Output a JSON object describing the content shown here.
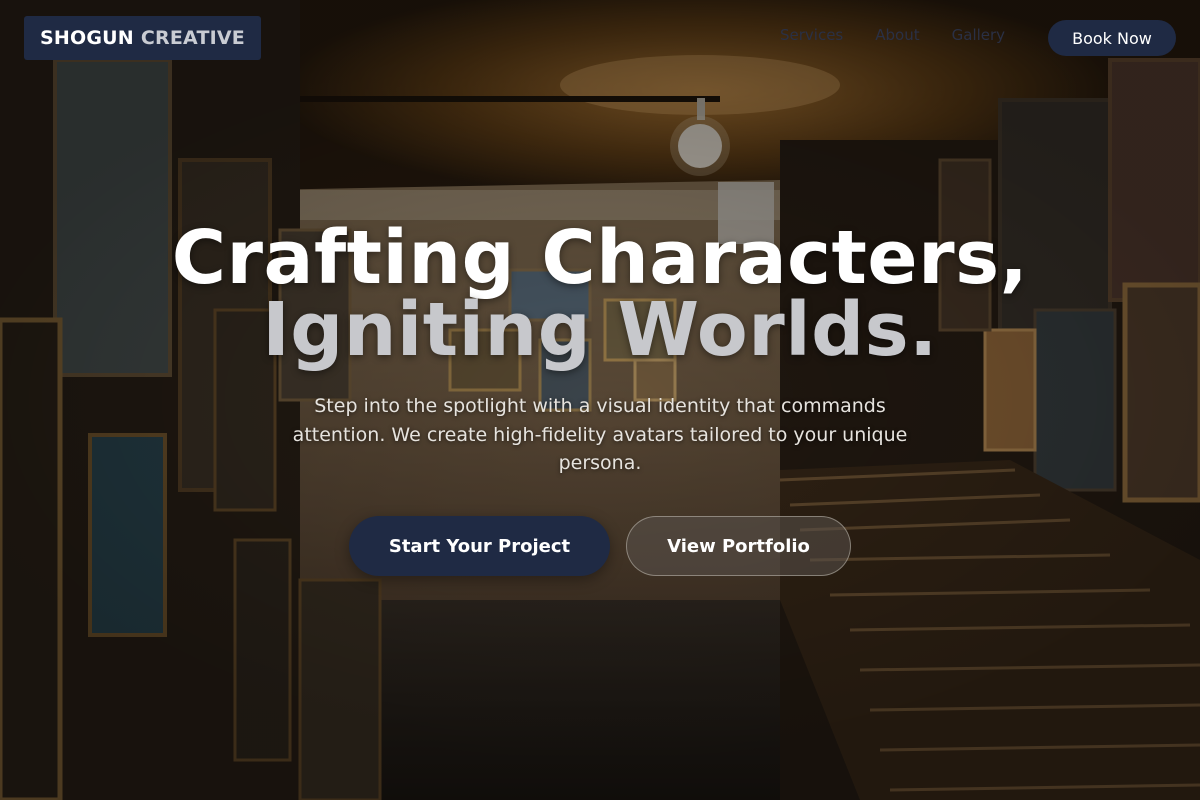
{
  "header": {
    "logo": {
      "word1": "SHOGUN",
      "word2": "CREATIVE"
    },
    "nav": [
      {
        "label": "Services"
      },
      {
        "label": "About"
      },
      {
        "label": "Gallery"
      }
    ],
    "book_label": "Book Now"
  },
  "hero": {
    "title_line1": "Crafting Characters,",
    "title_line2": "Igniting Worlds.",
    "subtitle": "Step into the spotlight with a visual identity that commands attention. We create high-fidelity avatars tailored to your unique persona.",
    "primary_label": "Start Your Project",
    "secondary_label": "View Portfolio"
  },
  "colors": {
    "brand_navy": "#1f2a44",
    "hero_title": "#ffffff",
    "hero_title_muted": "#c7c8cc"
  },
  "icons": [
    "ceiling-light-bulb"
  ]
}
